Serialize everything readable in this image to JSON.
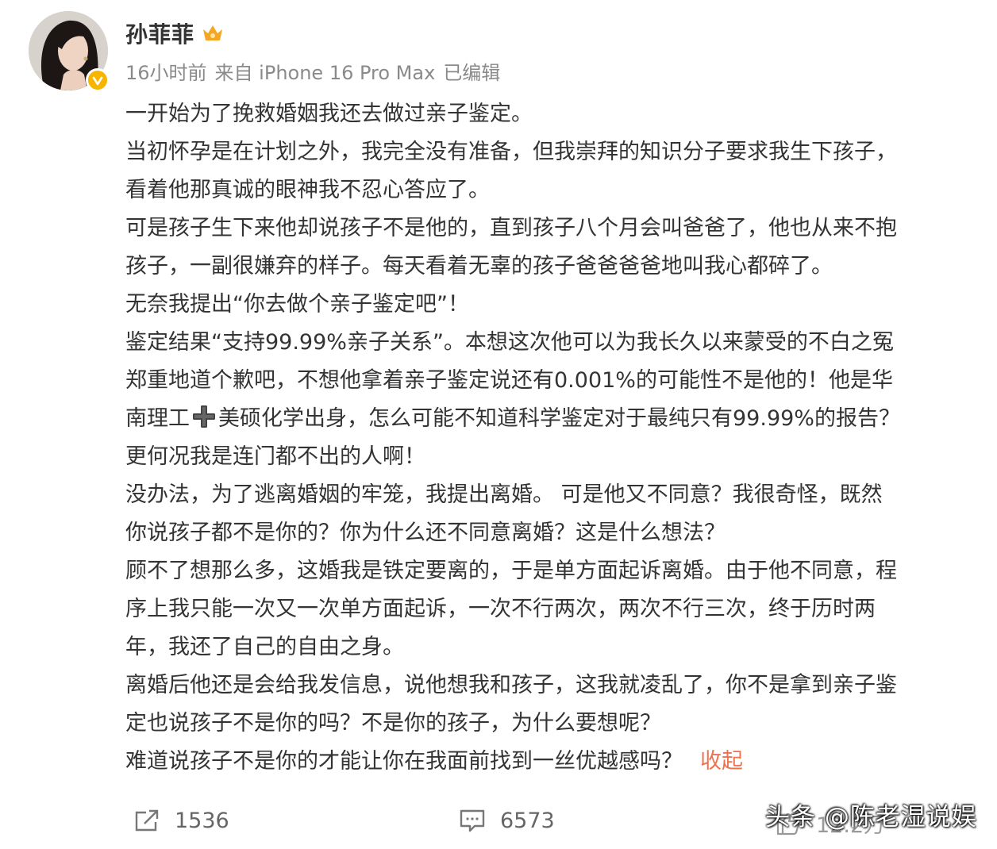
{
  "post": {
    "username": "孙菲菲",
    "meta": {
      "time": "16小时前",
      "source": "来自 iPhone 16 Pro Max",
      "edited": "已编辑"
    },
    "lines": [
      "一开始为了挽救婚姻我还去做过亲子鉴定。",
      "当初怀孕是在计划之外，我完全没有准备，但我崇拜的知识分子要求我生下孩子，",
      "看着他那真诚的眼神我不忍心答应了。",
      "可是孩子生下来他却说孩子不是他的，直到孩子八个月会叫爸爸了，他也从来不抱",
      "孩子，一副很嫌弃的样子。每天看着无辜的孩子爸爸爸爸地叫我心都碎了。",
      "无奈我提出“你去做个亲子鉴定吧”！",
      "鉴定结果“支持99.99%亲子关系”。本想这次他可以为我长久以来蒙受的不白之冤",
      "郑重地道个歉吧，不想他拿着亲子鉴定说还有0.001%的可能性不是他的！他是华"
    ],
    "line9_before": "南理工",
    "line9_after": "美硕化学出身，怎么可能不知道科学鉴定对于最纯只有99.99%的报告？",
    "lines_b": [
      "更何况我是连门都不出的人啊！",
      "没办法，为了逃离婚姻的牢笼，我提出离婚。 可是他又不同意？我很奇怪，既然",
      "你说孩子都不是你的？你为什么还不同意离婚？这是什么想法？",
      "顾不了想那么多，这婚我是铁定要离的，于是单方面起诉离婚。由于他不同意，程",
      "序上我只能一次又一次单方面起诉，一次不行两次，两次不行三次，终于历时两",
      "年，我还了自己的自由之身。",
      "离婚后他还是会给我发信息，说他想我和孩子，这我就凌乱了，你不是拿到亲子鉴",
      "定也说孩子不是你的吗？不是你的孩子，为什么要想呢？"
    ],
    "last_line": "难道说孩子不是你的才能让你在我面前找到一丝优越感吗？",
    "collapse_label": "收起"
  },
  "actions": {
    "repost_count": "1536",
    "comment_count": "6573",
    "like_count": "12.2万"
  },
  "watermark": "头条 @陈老湿说娱",
  "colors": {
    "text": "#333333",
    "meta": "#8a8a8a",
    "link": "#eb7350",
    "verified": "#f7b500"
  },
  "icons": [
    "avatar",
    "verified-badge-icon",
    "vip-crown-icon",
    "heavy-plus-emoji-icon",
    "repost-icon",
    "comment-icon",
    "like-icon"
  ]
}
